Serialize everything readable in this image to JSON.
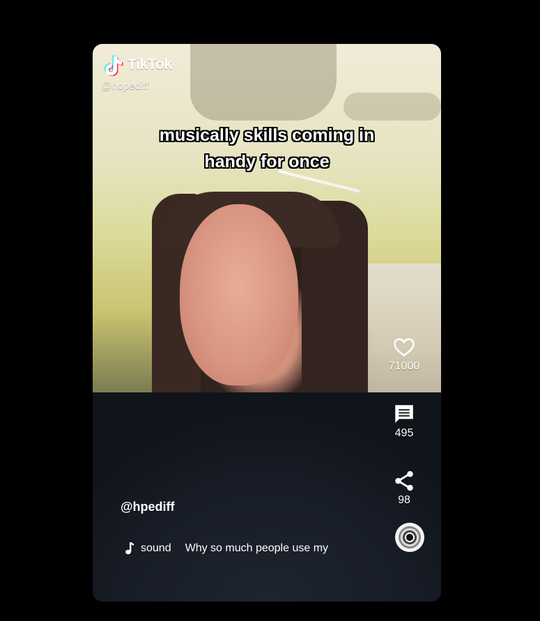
{
  "brand": {
    "name": "TikTok",
    "logo_icon": "tiktok-note-logo"
  },
  "video": {
    "author_watermark": "@hopediff",
    "caption_line1": "musically skills coming in",
    "caption_line2": "handy for once",
    "username": "@hpediff",
    "sound_label": "sound",
    "sound_title": "Why so much people use my"
  },
  "actions": {
    "likes": {
      "icon": "heart-icon",
      "count": "71000"
    },
    "comments": {
      "icon": "comment-icon",
      "count": "495"
    },
    "shares": {
      "icon": "share-icon",
      "count": "98"
    },
    "music_disc": {
      "icon": "music-disc-icon"
    }
  },
  "colors": {
    "background": "#000000",
    "text": "#ffffff",
    "logo_cyan": "#25f4ee",
    "logo_red": "#fe2c55"
  }
}
